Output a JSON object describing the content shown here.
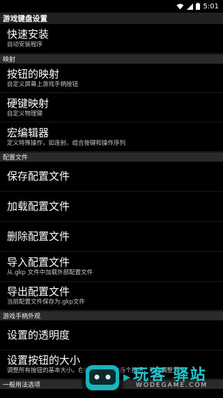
{
  "status_bar": {
    "time": "5:01",
    "icons": [
      "wifi-icon",
      "signal-icon",
      "battery-icon"
    ]
  },
  "title": "游戏键盘设置",
  "sections": [
    {
      "header": null,
      "items": [
        {
          "label": "快速安装",
          "sub": "自动安装程序"
        }
      ]
    },
    {
      "header": "映射",
      "items": [
        {
          "label": "按钮的映射",
          "sub": "自定义屏幕上游戏手柄按钮"
        },
        {
          "label": "硬键映射",
          "sub": "自定义物理键"
        },
        {
          "label": "宏编辑器",
          "sub": "定义特殊操作，如连射、组合按键和操作序列"
        }
      ]
    },
    {
      "header": "配置文件",
      "items": [
        {
          "label": "保存配置文件",
          "sub": ""
        },
        {
          "label": "加载配置文件",
          "sub": ""
        },
        {
          "label": "删除配置文件",
          "sub": ""
        },
        {
          "label": "导入配置文件",
          "sub": "从.gkp 文件中加载外部配置文件"
        },
        {
          "label": "导出配置文件",
          "sub": "当前配置文件保存为.gkp文件"
        }
      ]
    },
    {
      "header": "游戏手柄外观",
      "items": [
        {
          "label": "设置的透明度",
          "sub": ""
        },
        {
          "label": "设置按钮的大小",
          "sub": "调整所有按钮的基本大小。在编辑模式中的各个按钮，可以调整大小。"
        }
      ]
    },
    {
      "header": "一般用法选项",
      "items": []
    }
  ],
  "watermark": {
    "brand": "玩客 驿站",
    "url": "WODEGAME.COM"
  },
  "colors": {
    "background": "#000000",
    "section_bg": "#2a2a2a",
    "title_bg": "#202020",
    "watermark_teal": "#1ec8c8"
  }
}
